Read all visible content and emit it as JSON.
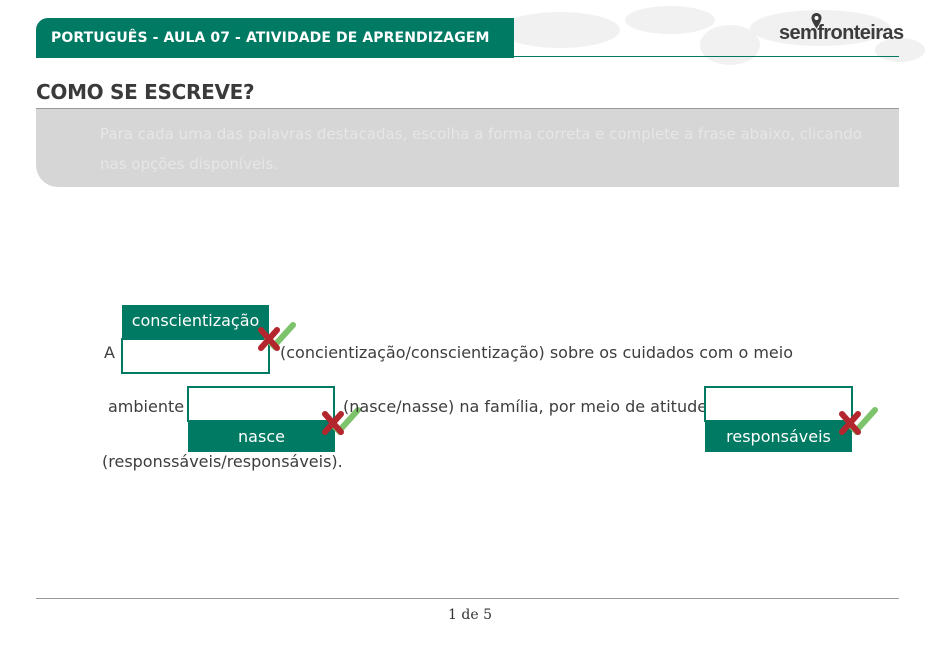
{
  "header": {
    "title": "PORTUGUÊS - AULA 07 - ATIVIDADE DE APRENDIZAGEM",
    "logo_part1": "sem",
    "logo_part2": "fronteiras"
  },
  "section": {
    "title": "COMO SE ESCREVE?",
    "instruction": "Para cada uma das palavras destacadas, escolha a forma correta e complete a frase abaixo, clicando nas opções disponíveis."
  },
  "exercise": {
    "line1_start": "A",
    "line1_hint": "(concientização/conscientização) sobre os cuidados com o meio",
    "line2_start": "ambiente",
    "line2_hint": "(nasce/nasse) na família, por meio de atitudes",
    "line3_hint": "(responssáveis/responsáveis).",
    "answers": [
      "conscientização",
      "nasce",
      "responsáveis"
    ]
  },
  "icons": {
    "wrong": "x-mark-icon",
    "right": "check-mark-icon"
  },
  "colors": {
    "brand": "#007a63",
    "wrong": "#b3262d",
    "right": "#7dc36b"
  },
  "footer": {
    "page_indicator": "1 de 5"
  }
}
